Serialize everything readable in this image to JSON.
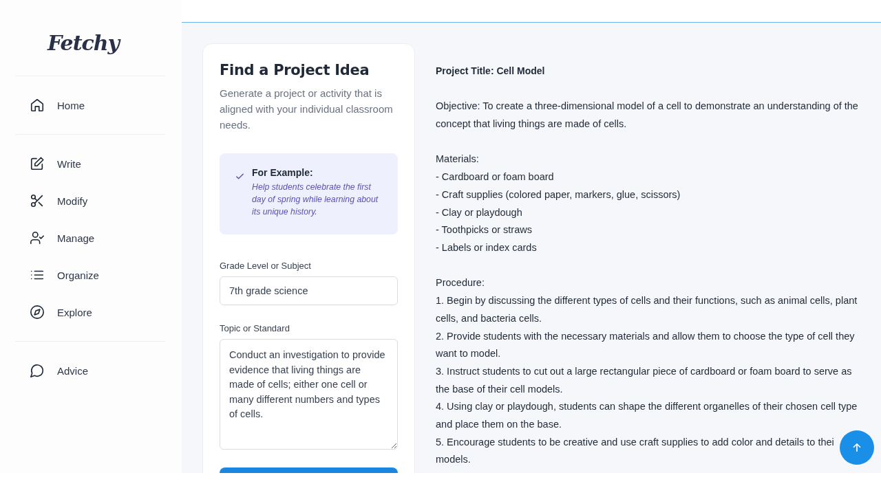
{
  "sidebar": {
    "logo": "Fetchy",
    "sections": [
      [
        {
          "label": "Home",
          "kind": "home"
        }
      ],
      [
        {
          "label": "Write",
          "kind": "write"
        },
        {
          "label": "Modify",
          "kind": "modify"
        },
        {
          "label": "Manage",
          "kind": "manage"
        },
        {
          "label": "Organize",
          "kind": "organize"
        },
        {
          "label": "Explore",
          "kind": "explore"
        }
      ],
      [
        {
          "label": "Advice",
          "kind": "advice"
        }
      ]
    ]
  },
  "form": {
    "title": "Find a Project Idea",
    "description": "Generate a project or activity that is aligned with your individual classroom needs.",
    "example": {
      "heading": "For Example:",
      "text": "Help students celebrate the first day of spring while learning about its unique history."
    },
    "fields": [
      {
        "kind": "input",
        "label": "Grade Level or Subject",
        "value": "7th grade science"
      },
      {
        "kind": "textarea",
        "label": "Topic or Standard",
        "value": "Conduct an investigation to provide evidence that living things are made of cells; either one cell or many different numbers and types of cells."
      }
    ]
  },
  "result": {
    "title": "Project Title: Cell Model",
    "objective": "Objective: To create a three-dimensional model of a cell to demonstrate an understanding of the concept that living things are made of cells.",
    "materials_heading": "Materials:",
    "materials": [
      "- Cardboard or foam board",
      "- Craft supplies (colored paper, markers, glue, scissors)",
      "- Clay or playdough",
      "- Toothpicks or straws",
      "- Labels or index cards"
    ],
    "procedure_heading": "Procedure:",
    "procedure": [
      "1. Begin by discussing the different types of cells and their functions, such as animal cells, plant cells, and bacteria cells.",
      "2. Provide students with the necessary materials and allow them to choose the type of cell they want to model.",
      "3. Instruct students to cut out a large rectangular piece of cardboard or foam board to serve as the base of their cell models.",
      "4. Using clay or playdough, students can shape the different organelles of their chosen cell type and place them on the base.",
      "5. Encourage students to be creative and use craft supplies to add color and details to thei",
      "models."
    ]
  }
}
